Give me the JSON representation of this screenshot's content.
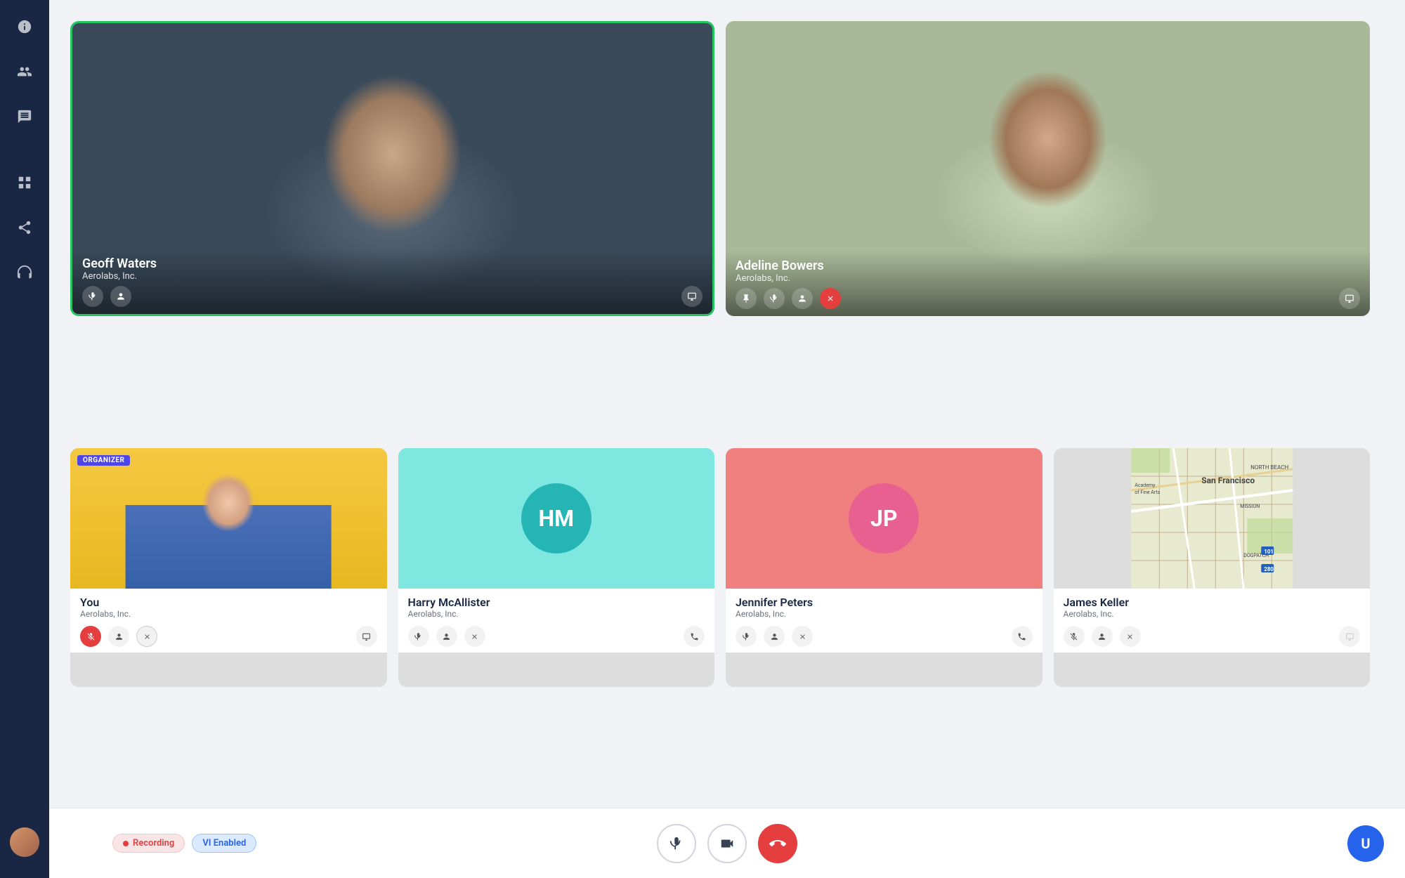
{
  "sidebar": {
    "icons": [
      {
        "name": "info-icon",
        "symbol": "ℹ"
      },
      {
        "name": "people-icon",
        "symbol": "👥"
      },
      {
        "name": "chat-icon",
        "symbol": "💬"
      },
      {
        "name": "grid-icon",
        "symbol": "⊞"
      },
      {
        "name": "share-icon",
        "symbol": "↑"
      },
      {
        "name": "headset-icon",
        "symbol": "🎧"
      }
    ],
    "user_initial": "U"
  },
  "participants": {
    "top": [
      {
        "id": "geoff",
        "name": "Geoff Waters",
        "org": "Aerolabs, Inc.",
        "active_speaker": true,
        "controls": [
          "mic",
          "person",
          "screen"
        ]
      },
      {
        "id": "adeline",
        "name": "Adeline Bowers",
        "org": "Aerolabs, Inc.",
        "active_speaker": false,
        "controls": [
          "pin",
          "mic",
          "person",
          "close",
          "screen"
        ]
      }
    ],
    "bottom": [
      {
        "id": "you",
        "name": "You",
        "org": "Aerolabs, Inc.",
        "organizer": true,
        "muted": true,
        "controls": [
          "mic_muted",
          "person",
          "close",
          "screen"
        ]
      },
      {
        "id": "harry",
        "name": "Harry McAllister",
        "org": "Aerolabs, Inc.",
        "initials": "HM",
        "avatar_color": "#26b5b5",
        "bg_color": "#7ee8e0",
        "controls": [
          "mic",
          "person",
          "close",
          "phone"
        ]
      },
      {
        "id": "jennifer",
        "name": "Jennifer Peters",
        "org": "Aerolabs, Inc.",
        "initials": "JP",
        "avatar_color": "#e86090",
        "bg_color": "#f08080",
        "controls": [
          "mic",
          "person",
          "close",
          "phone"
        ]
      },
      {
        "id": "james",
        "name": "James Keller",
        "org": "Aerolabs, Inc.",
        "map": true,
        "controls": [
          "mic_muted",
          "person",
          "close",
          "screen"
        ]
      }
    ]
  },
  "toolbar": {
    "mic_label": "🎤",
    "video_label": "📹",
    "end_label": "✕",
    "recording_label": "Recording",
    "vi_label": "VI Enabled"
  },
  "user_corner_initial": "U"
}
